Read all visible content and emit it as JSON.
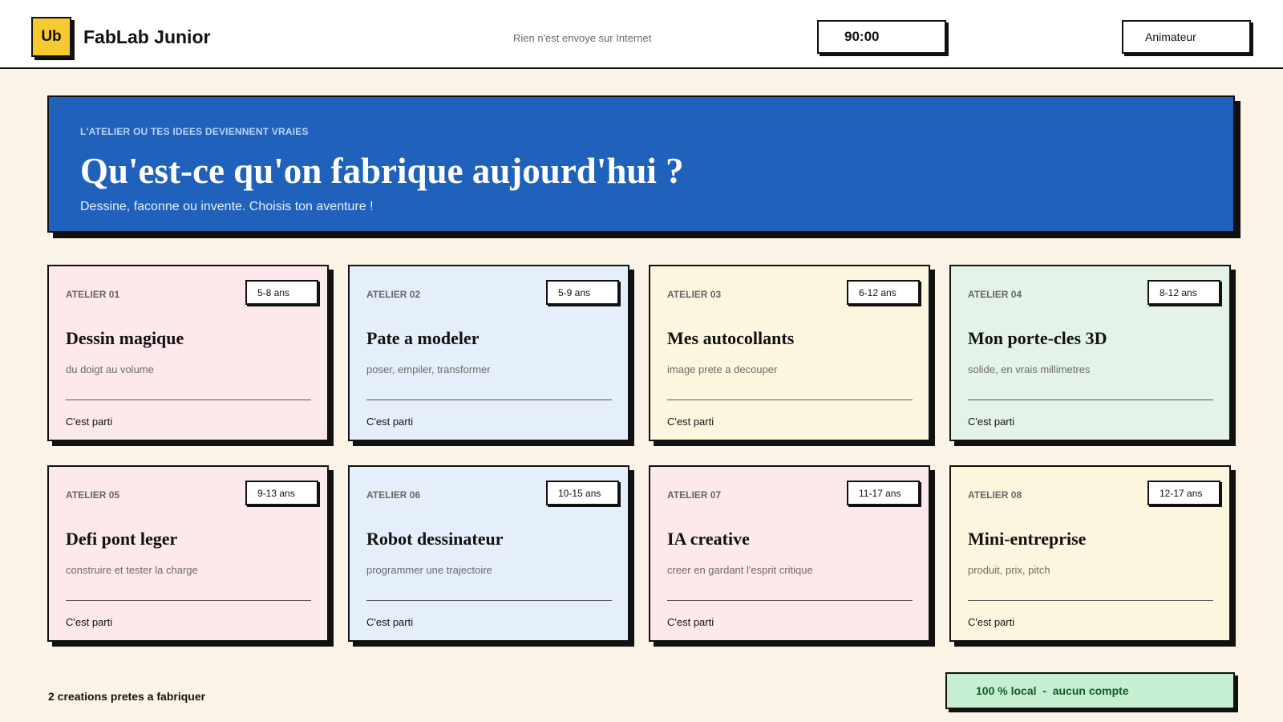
{
  "header": {
    "logo": "Ub",
    "title": "FabLab Junior",
    "privacy_note": "Rien n'est envoye sur Internet",
    "timer": "90:00",
    "role": "Animateur"
  },
  "hero": {
    "kicker": "L'ATELIER OU TES IDEES DEVIENNENT VRAIES",
    "title": "Qu'est-ce qu'on fabrique aujourd'hui ?",
    "subtitle": "Dessine, faconne ou invente. Choisis ton aventure !"
  },
  "cards": [
    {
      "num": "ATELIER 01",
      "age": "5-8 ans",
      "title": "Dessin magique",
      "subtitle": "du doigt au volume",
      "cta": "C'est parti",
      "color": "#fde8ec"
    },
    {
      "num": "ATELIER 02",
      "age": "5-9 ans",
      "title": "Pate a modeler",
      "subtitle": "poser, empiler, transformer",
      "cta": "C'est parti",
      "color": "#e5effb"
    },
    {
      "num": "ATELIER 03",
      "age": "6-12 ans",
      "title": "Mes autocollants",
      "subtitle": "image prete a decouper",
      "cta": "C'est parti",
      "color": "#fcf6de"
    },
    {
      "num": "ATELIER 04",
      "age": "8-12 ans",
      "title": "Mon porte-cles 3D",
      "subtitle": "solide, en vrais millimetres",
      "cta": "C'est parti",
      "color": "#e4f3e7"
    },
    {
      "num": "ATELIER 05",
      "age": "9-13 ans",
      "title": "Defi pont leger",
      "subtitle": "construire et tester la charge",
      "cta": "C'est parti",
      "color": "#fde8ec"
    },
    {
      "num": "ATELIER 06",
      "age": "10-15 ans",
      "title": "Robot dessinateur",
      "subtitle": "programmer une trajectoire",
      "cta": "C'est parti",
      "color": "#e5effb"
    },
    {
      "num": "ATELIER 07",
      "age": "11-17 ans",
      "title": "IA creative",
      "subtitle": "creer en gardant l'esprit critique",
      "cta": "C'est parti",
      "color": "#fde8ec"
    },
    {
      "num": "ATELIER 08",
      "age": "12-17 ans",
      "title": "Mini-entreprise",
      "subtitle": "produit, prix, pitch",
      "cta": "C'est parti",
      "color": "#fcf6de"
    }
  ],
  "footer": {
    "count": "2 creations pretes a fabriquer",
    "badge": "100 % local  -  aucun compte"
  },
  "colors": {
    "background": "#fbf4e6",
    "hero": "#2062bb",
    "logo": "#f6c92f",
    "local_badge": "#c6efd2"
  }
}
